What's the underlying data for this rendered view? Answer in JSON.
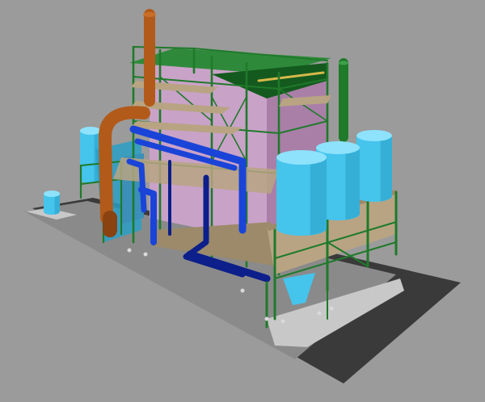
{
  "scene": {
    "background_color": "#9b9b9b",
    "colors": {
      "ground_slab_top": "#8a8a8a",
      "ground_slab_edge": "#3a3a3a",
      "light_apron": "#c8c8c8",
      "steel_frame": "#1f7a2a",
      "steel_frame_dark": "#145a1e",
      "boiler_casing": "#c9a2c8",
      "boiler_casing_dark": "#a97fa8",
      "platform_deck": "#b8a483",
      "platform_deck_dark": "#9c8a6a",
      "silo": "#45c4ec",
      "silo_dark": "#2a9fc6",
      "silo_top": "#8ee2fb",
      "pipe_blue": "#1a44d8",
      "pipe_navy": "#0c1f8a",
      "pipe_orange": "#b25a1a",
      "pipe_orange_dark": "#8a4210",
      "stack_green": "#1f7a2a",
      "roof_green": "#2e8a3a"
    },
    "icons": [
      "boiler-structure-model"
    ]
  }
}
